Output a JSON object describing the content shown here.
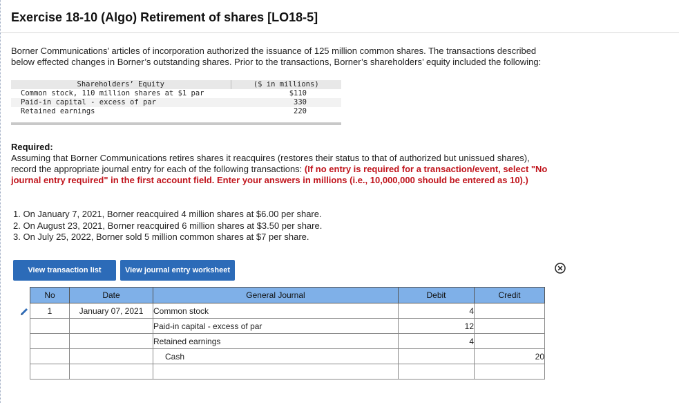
{
  "header": {
    "title": "Exercise 18-10 (Algo) Retirement of shares [LO18-5]"
  },
  "intro": {
    "line1": "Borner Communications’ articles of incorporation authorized the issuance of 125 million common shares. The transactions described",
    "line2": "below effected changes in Borner’s outstanding shares. Prior to the transactions, Borner’s shareholders’ equity included the following:"
  },
  "equity_table": {
    "header_label": "Shareholders’ Equity",
    "header_amount": "($ in millions)",
    "rows": [
      {
        "label": "Common stock, 110 million shares at $1 par",
        "amount": "$110"
      },
      {
        "label": "Paid-in capital - excess of par",
        "amount": "330"
      },
      {
        "label": "Retained earnings",
        "amount": "220"
      }
    ]
  },
  "requirement": {
    "title": "Required:",
    "text1": "Assuming that Borner Communications retires shares it reacquires (restores their status to that of authorized but unissued shares),",
    "text2": "record the appropriate journal entry for each of the following transactions: ",
    "red1": "(If no entry is required for a transaction/event, select \"No",
    "red2": "journal entry required\" in the first account field. Enter your answers in millions (i.e., 10,000,000 should be entered as 10).)"
  },
  "transactions": [
    "1. On January 7, 2021, Borner reacquired 4 million shares at $6.00 per share.",
    "2. On August 23, 2021, Borner reacquired 6 million shares at $3.50 per share.",
    "3. On July 25, 2022, Borner sold 5 million common shares at $7 per share."
  ],
  "buttons": {
    "view_transactions": "View transaction list",
    "view_worksheet": "View journal entry worksheet"
  },
  "journal": {
    "headers": {
      "no": "No",
      "date": "Date",
      "account": "General Journal",
      "debit": "Debit",
      "credit": "Credit"
    },
    "rows": [
      {
        "no": "1",
        "date": "January 07, 2021",
        "account": "Common stock",
        "debit": "4",
        "credit": ""
      },
      {
        "no": "",
        "date": "",
        "account": "Paid-in capital - excess of par",
        "debit": "12",
        "credit": ""
      },
      {
        "no": "",
        "date": "",
        "account": "Retained earnings",
        "debit": "4",
        "credit": ""
      },
      {
        "no": "",
        "date": "",
        "account": "Cash",
        "debit": "",
        "credit": "20"
      },
      {
        "no": "",
        "date": "",
        "account": "",
        "debit": "",
        "credit": ""
      }
    ]
  },
  "colors": {
    "button_blue": "#2c6bb8",
    "table_header_blue": "#7fb0e8",
    "instruction_red": "#c0141c"
  },
  "icons": [
    "edit-pencil-icon",
    "close-circle-icon"
  ]
}
